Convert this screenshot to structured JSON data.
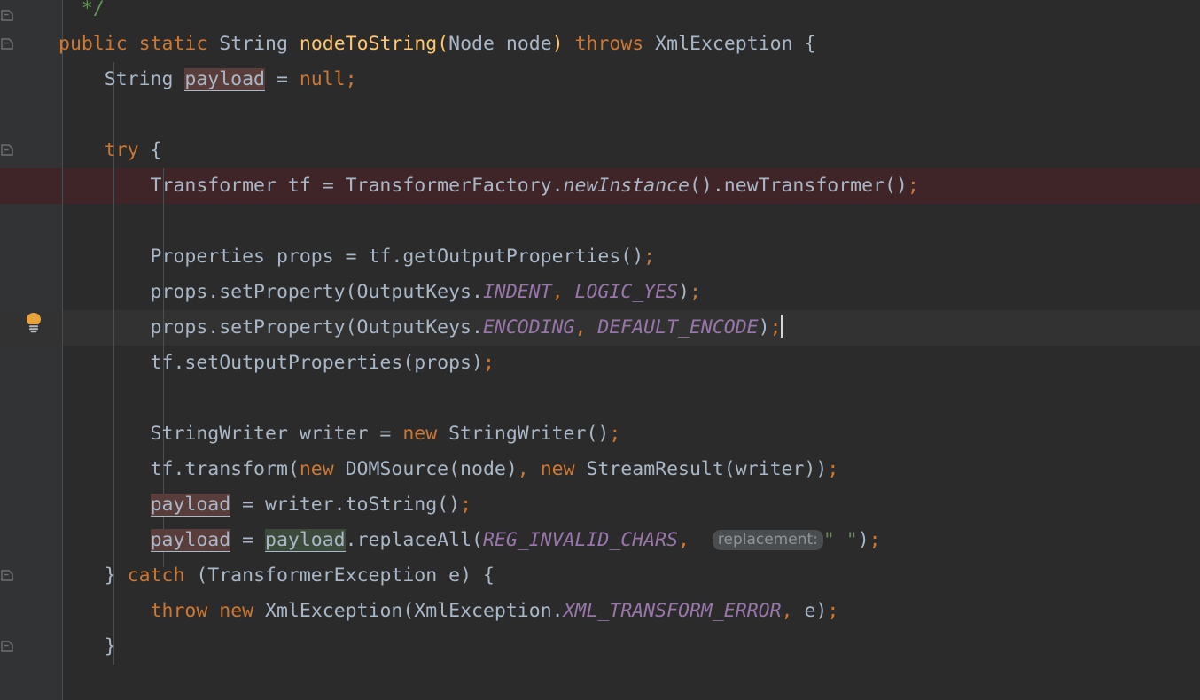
{
  "editor": {
    "kind": "java-source-editor",
    "theme": "darcula",
    "background": "#2b2b2b",
    "gutter_background": "#313335",
    "caret_line_background": "#323232",
    "error_line_background": "#3f2527",
    "colors": {
      "default_text": "#a9b7c6",
      "keyword": "#cc7832",
      "method_declaration": "#ffc66d",
      "constant": "#9876aa",
      "comment": "#629755",
      "string": "#6a8759",
      "number": "#6897bb",
      "write_usage_highlight": "#593d3b",
      "read_usage_highlight": "#3b4a3a",
      "inline_hint_background": "#4a4d4f",
      "inline_hint_text": "#909496",
      "bulb_color": "#e8a33d",
      "indent_guide": "#4b4e50"
    },
    "inline_hints": [
      {
        "label": "replacement:"
      }
    ],
    "gutter_icons": [
      {
        "name": "fold-arrow",
        "line": 1
      },
      {
        "name": "fold-arrow",
        "line": 2
      },
      {
        "name": "fold-arrow",
        "line": 5
      },
      {
        "name": "intention-bulb",
        "line": 11
      },
      {
        "name": "fold-arrow",
        "line": 17
      },
      {
        "name": "fold-arrow",
        "line": 19
      }
    ],
    "lines": [
      {
        "n": 1,
        "indent": 0,
        "state": "normal",
        "text": "  */"
      },
      {
        "n": 2,
        "indent": 0,
        "state": "normal",
        "text": "public static String nodeToString(Node node) throws XmlException {"
      },
      {
        "n": 3,
        "indent": 1,
        "state": "normal",
        "text": "    String payload = null;"
      },
      {
        "n": 4,
        "indent": 1,
        "state": "normal",
        "text": ""
      },
      {
        "n": 5,
        "indent": 1,
        "state": "normal",
        "text": "    try {"
      },
      {
        "n": 6,
        "indent": 2,
        "state": "error",
        "text": "        Transformer tf = TransformerFactory.newInstance().newTransformer();"
      },
      {
        "n": 7,
        "indent": 2,
        "state": "normal",
        "text": ""
      },
      {
        "n": 8,
        "indent": 2,
        "state": "normal",
        "text": "        Properties props = tf.getOutputProperties();"
      },
      {
        "n": 9,
        "indent": 2,
        "state": "normal",
        "text": "        props.setProperty(OutputKeys.INDENT, LOGIC_YES);"
      },
      {
        "n": 10,
        "indent": 2,
        "state": "caret",
        "text": "        props.setProperty(OutputKeys.ENCODING, DEFAULT_ENCODE);"
      },
      {
        "n": 11,
        "indent": 2,
        "state": "normal",
        "text": "        tf.setOutputProperties(props);"
      },
      {
        "n": 12,
        "indent": 2,
        "state": "normal",
        "text": ""
      },
      {
        "n": 13,
        "indent": 2,
        "state": "normal",
        "text": "        StringWriter writer = new StringWriter();"
      },
      {
        "n": 14,
        "indent": 2,
        "state": "normal",
        "text": "        tf.transform(new DOMSource(node), new StreamResult(writer));"
      },
      {
        "n": 15,
        "indent": 2,
        "state": "normal",
        "text": "        payload = writer.toString();"
      },
      {
        "n": 16,
        "indent": 2,
        "state": "normal",
        "text": "        payload = payload.replaceAll(REG_INVALID_CHARS, replacement: \" \");"
      },
      {
        "n": 17,
        "indent": 1,
        "state": "normal",
        "text": "    } catch (TransformerException e) {"
      },
      {
        "n": 18,
        "indent": 2,
        "state": "normal",
        "text": "        throw new XmlException(XmlException.XML_TRANSFORM_ERROR, e);"
      },
      {
        "n": 19,
        "indent": 1,
        "state": "normal",
        "text": "    }"
      }
    ],
    "tokens": {
      "l1_comment": "  */",
      "l2_public": "public",
      "l2_sp1": " ",
      "l2_static": "static",
      "l2_sp2": " ",
      "l2_String": "String",
      "l2_sp3": " ",
      "l2_method": "nodeToString",
      "l2_open": "(",
      "l2_Node": "Node node",
      "l2_close": ") ",
      "l2_throws": "throws",
      "l2_exc": " XmlException {",
      "l3_String": "    String ",
      "l3_payload": "payload",
      "l3_eq": " = ",
      "l3_null": "null",
      "l3_semi": ";",
      "l5_try": "    try",
      "l5_brace": " {",
      "l6_a": "        Transformer tf = TransformerFactory.",
      "l6_static": "newInstance",
      "l6_b": "().newTransformer()",
      "l6_semi": ";",
      "l8_a": "        Properties props = tf.getOutputProperties()",
      "l8_semi": ";",
      "l9_a": "        props.setProperty(OutputKeys.",
      "l9_c1": "INDENT",
      "l9_comma": ",",
      "l9_sp": " ",
      "l9_c2": "LOGIC_YES",
      "l9_b": ")",
      "l9_semi": ";",
      "l10_a": "        props.setProperty(OutputKeys.",
      "l10_c1": "ENCODING",
      "l10_comma": ",",
      "l10_sp": " ",
      "l10_c2": "DEFAULT_ENCODE",
      "l10_b": ")",
      "l10_semi": ";",
      "l11_a": "        tf.setOutputProperties(props)",
      "l11_semi": ";",
      "l13_a": "        StringWriter writer = ",
      "l13_new": "new",
      "l13_b": " StringWriter()",
      "l13_semi": ";",
      "l14_a": "        tf.transform(",
      "l14_new1": "new",
      "l14_b": " DOMSource(node)",
      "l14_comma": ",",
      "l14_sp": " ",
      "l14_new2": "new",
      "l14_c": " StreamResult(writer))",
      "l14_semi": ";",
      "l15_ind": "        ",
      "l15_payload": "payload",
      "l15_a": " = writer.toString()",
      "l15_semi": ";",
      "l16_ind": "        ",
      "l16_payload1": "payload",
      "l16_eq": " = ",
      "l16_payload2": "payload",
      "l16_a": ".replaceAll(",
      "l16_const": "REG_INVALID_CHARS",
      "l16_comma": ",",
      "l16_hint": "replacement:",
      "l16_str": "\" \"",
      "l16_b": ")",
      "l16_semi": ";",
      "l17_a": "    } ",
      "l17_catch": "catch",
      "l17_b": " (TransformerException e) {",
      "l18_ind": "        ",
      "l18_throw": "throw",
      "l18_sp": " ",
      "l18_new": "new",
      "l18_a": " XmlException(XmlException.",
      "l18_const": "XML_TRANSFORM_ERROR",
      "l18_comma": ",",
      "l18_b": " e)",
      "l18_semi": ";",
      "l19_a": "    }"
    }
  }
}
